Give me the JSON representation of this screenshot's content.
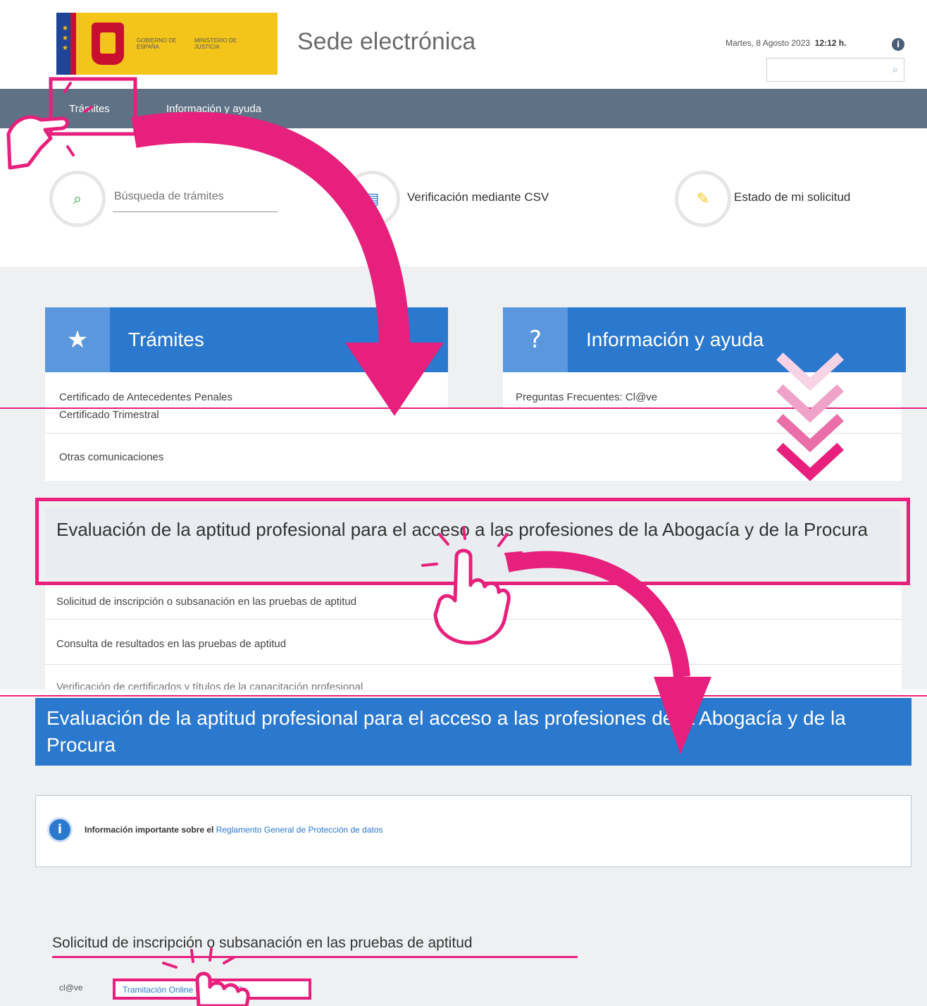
{
  "header": {
    "logo_gov": "GOBIERNO DE ESPAÑA",
    "logo_ministry": "MINISTERIO DE JUSTICIA",
    "site_title": "Sede electrónica",
    "date": "Martes, 8 Agosto 2023",
    "time": "12:12 h.",
    "search_placeholder": ""
  },
  "nav": {
    "items": [
      {
        "label": "Trámites"
      },
      {
        "label": "Información y ayuda"
      }
    ]
  },
  "quick_actions": {
    "search_placeholder": "Búsqueda de trámites",
    "csv_label": "Verificación mediante CSV",
    "status_label": "Estado de mi solicitud"
  },
  "panels": {
    "tramites": {
      "title": "Trámites",
      "rows": [
        "Certificado de Antecedentes Penales",
        "Certificado Trimestral",
        "Otras comunicaciones"
      ]
    },
    "ayuda": {
      "title": "Información y ayuda",
      "rows": [
        "Preguntas Frecuentes: Cl@ve"
      ]
    }
  },
  "evaluation": {
    "title": "Evaluación de la aptitud profesional para el acceso a las profesiones de la Abogacía y de la Procura",
    "rows": [
      "Solicitud de inscripción o subsanación en las pruebas de aptitud",
      "Consulta de resultados en las pruebas de aptitud",
      "Verificación de certificados y títulos de la capacitación profesional"
    ]
  },
  "detail": {
    "title": "Evaluación de la aptitud profesional para el acceso a las profesiones de la Abogacía y de la Procura",
    "notice_text": "Información importante sobre el",
    "notice_link": "Reglamento General de Protección de datos",
    "section_title": "Solicitud de inscripción o subsanación en las pruebas de aptitud",
    "clave_logo": "cl@ve",
    "clave_link": "Tramitación Online con CL@VE"
  },
  "colors": {
    "accent": "#e6207c",
    "primary_blue": "#2b78cf",
    "nav_bg": "#5f7285",
    "logo_yellow": "#f3c51a"
  }
}
